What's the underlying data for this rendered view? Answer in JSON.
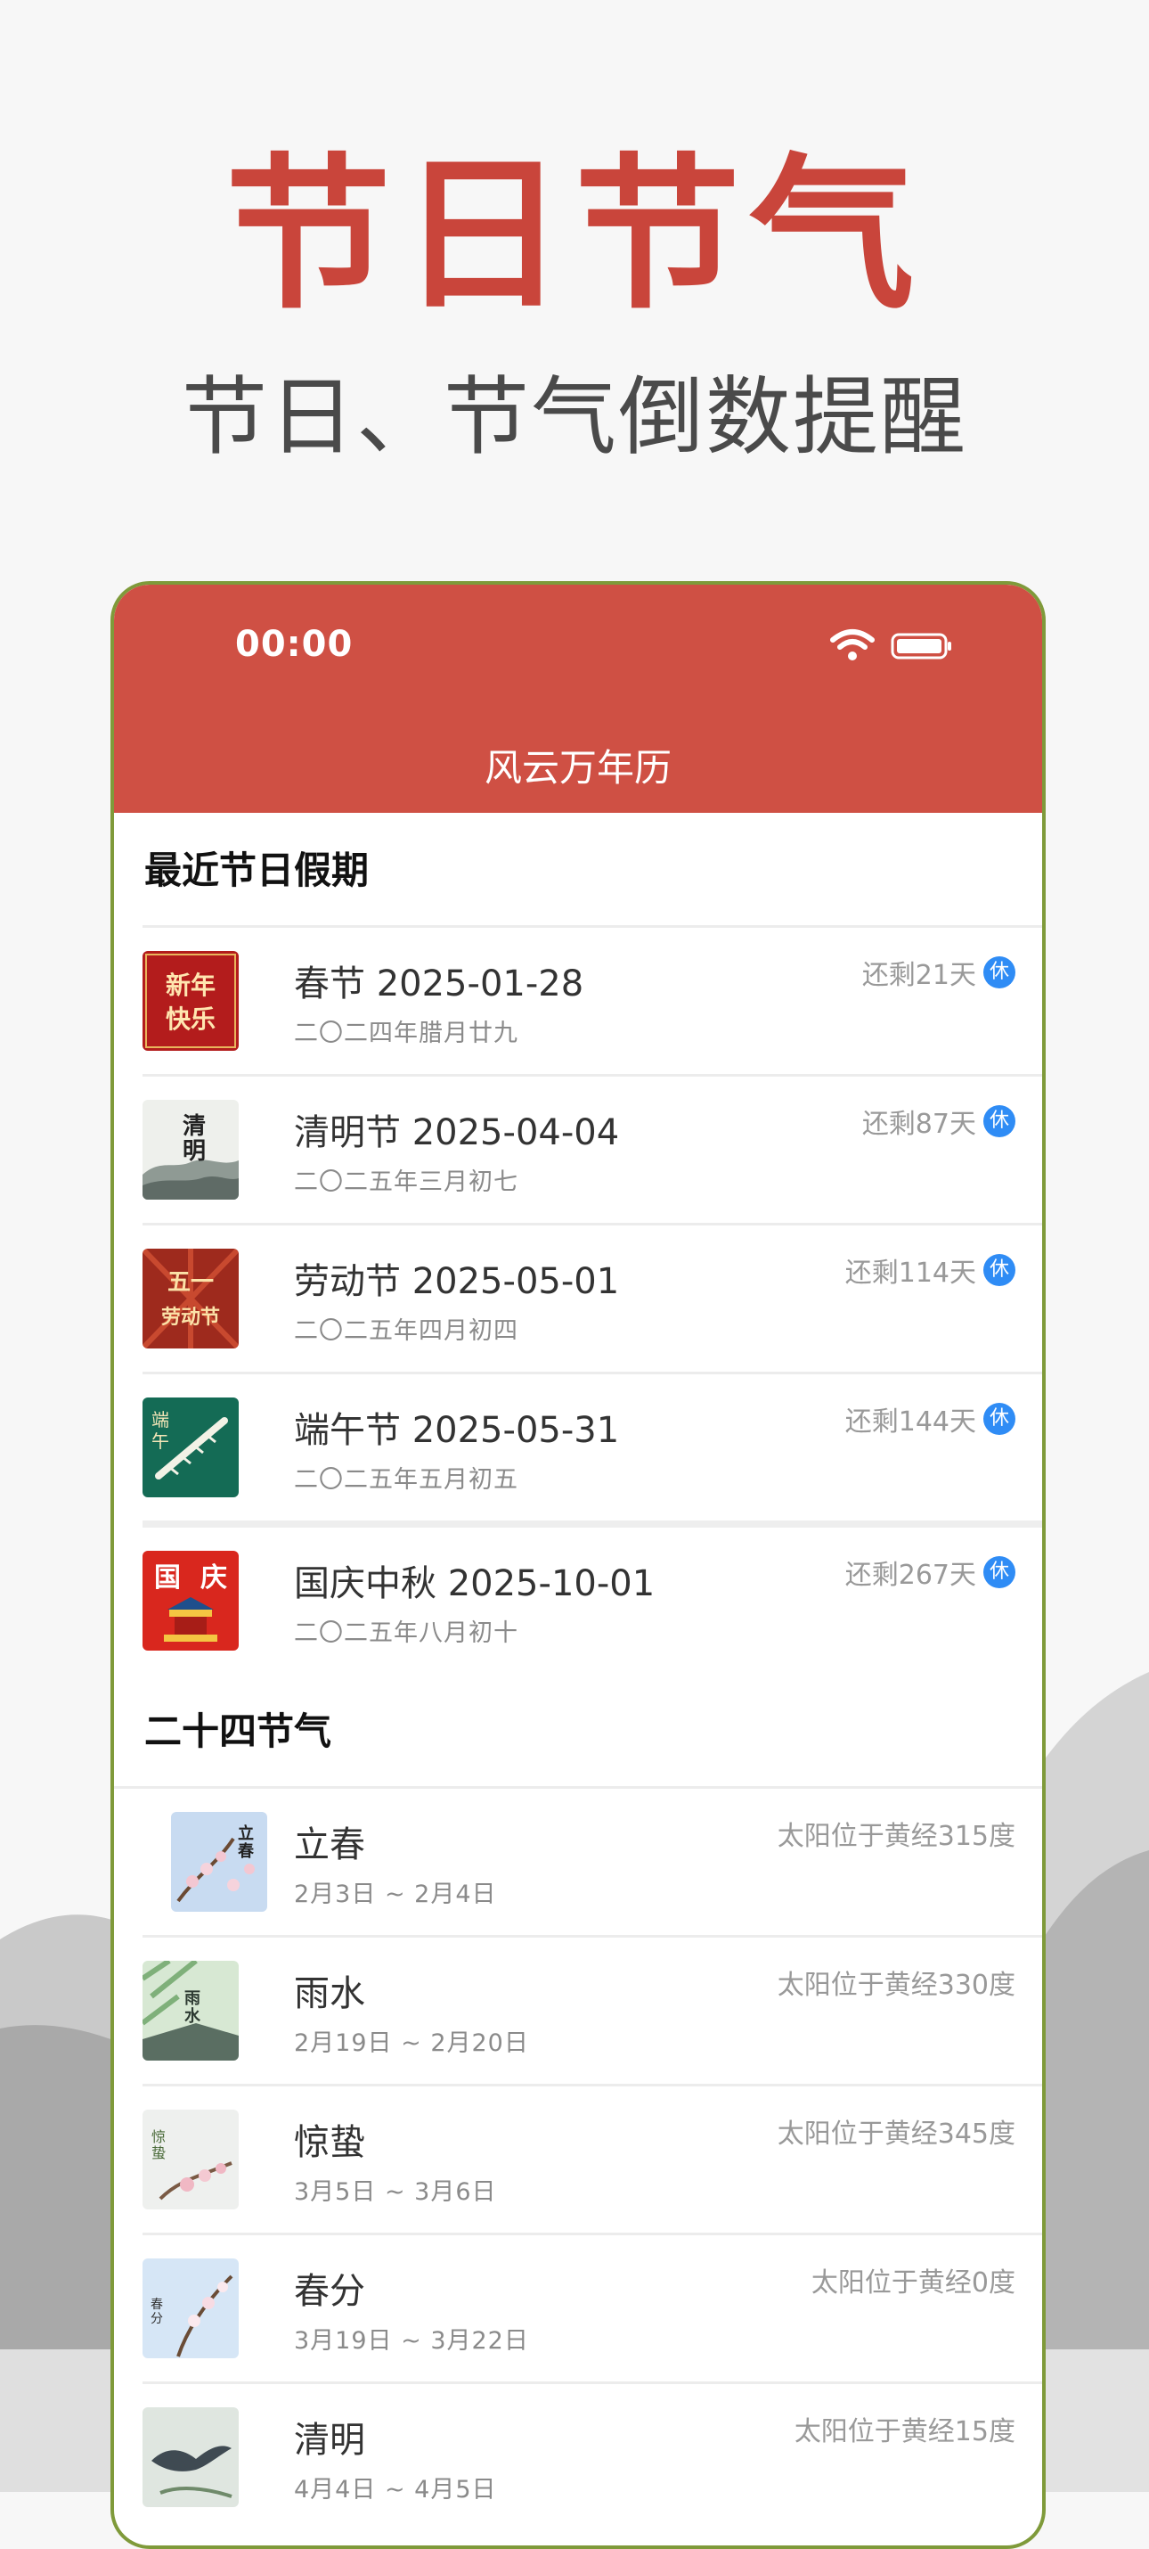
{
  "hero": {
    "title": "节日节气",
    "subtitle": "节日、节气倒数提醒"
  },
  "status_bar": {
    "time": "00:00"
  },
  "app": {
    "title": "风云万年历"
  },
  "holidays": {
    "section_title": "最近节日假期",
    "items": [
      {
        "title": "春节 2025-01-28",
        "lunar": "二〇二四年腊月廿九",
        "remaining": "还剩21天",
        "badge": "休",
        "thumb_text": [
          "新年",
          "快乐"
        ]
      },
      {
        "title": "清明节 2025-04-04",
        "lunar": "二〇二五年三月初七",
        "remaining": "还剩87天",
        "badge": "休",
        "thumb_text": [
          "清",
          "明"
        ]
      },
      {
        "title": "劳动节 2025-05-01",
        "lunar": "二〇二五年四月初四",
        "remaining": "还剩114天",
        "badge": "休",
        "thumb_text": [
          "五一",
          "劳动节"
        ]
      },
      {
        "title": "端午节 2025-05-31",
        "lunar": "二〇二五年五月初五",
        "remaining": "还剩144天",
        "badge": "休",
        "thumb_text": [
          "端",
          "午"
        ]
      },
      {
        "title": "国庆中秋 2025-10-01",
        "lunar": "二〇二五年八月初十",
        "remaining": "还剩267天",
        "badge": "休",
        "thumb_text": [
          "国",
          "庆"
        ]
      }
    ]
  },
  "solar_terms": {
    "section_title": "二十四节气",
    "items": [
      {
        "name": "立春",
        "dates": "2月3日 ~ 2月4日",
        "solar_longitude": "太阳位于黄经315度",
        "thumb_text": [
          "立",
          "春"
        ]
      },
      {
        "name": "雨水",
        "dates": "2月19日 ~ 2月20日",
        "solar_longitude": "太阳位于黄经330度",
        "thumb_text": [
          "雨",
          "水"
        ]
      },
      {
        "name": "惊蛰",
        "dates": "3月5日 ~ 3月6日",
        "solar_longitude": "太阳位于黄经345度",
        "thumb_text": [
          "惊",
          "蛰"
        ]
      },
      {
        "name": "春分",
        "dates": "3月19日 ~ 3月22日",
        "solar_longitude": "太阳位于黄经0度",
        "thumb_text": [
          "春",
          "分"
        ]
      },
      {
        "name": "清明",
        "dates": "4月4日 ~ 4月5日",
        "solar_longitude": "太阳位于黄经15度",
        "thumb_text": []
      }
    ]
  },
  "colors": {
    "brand_red": "#cf5044",
    "rest_badge_blue": "#2f8cf5",
    "phone_border": "#7f9a3a"
  }
}
